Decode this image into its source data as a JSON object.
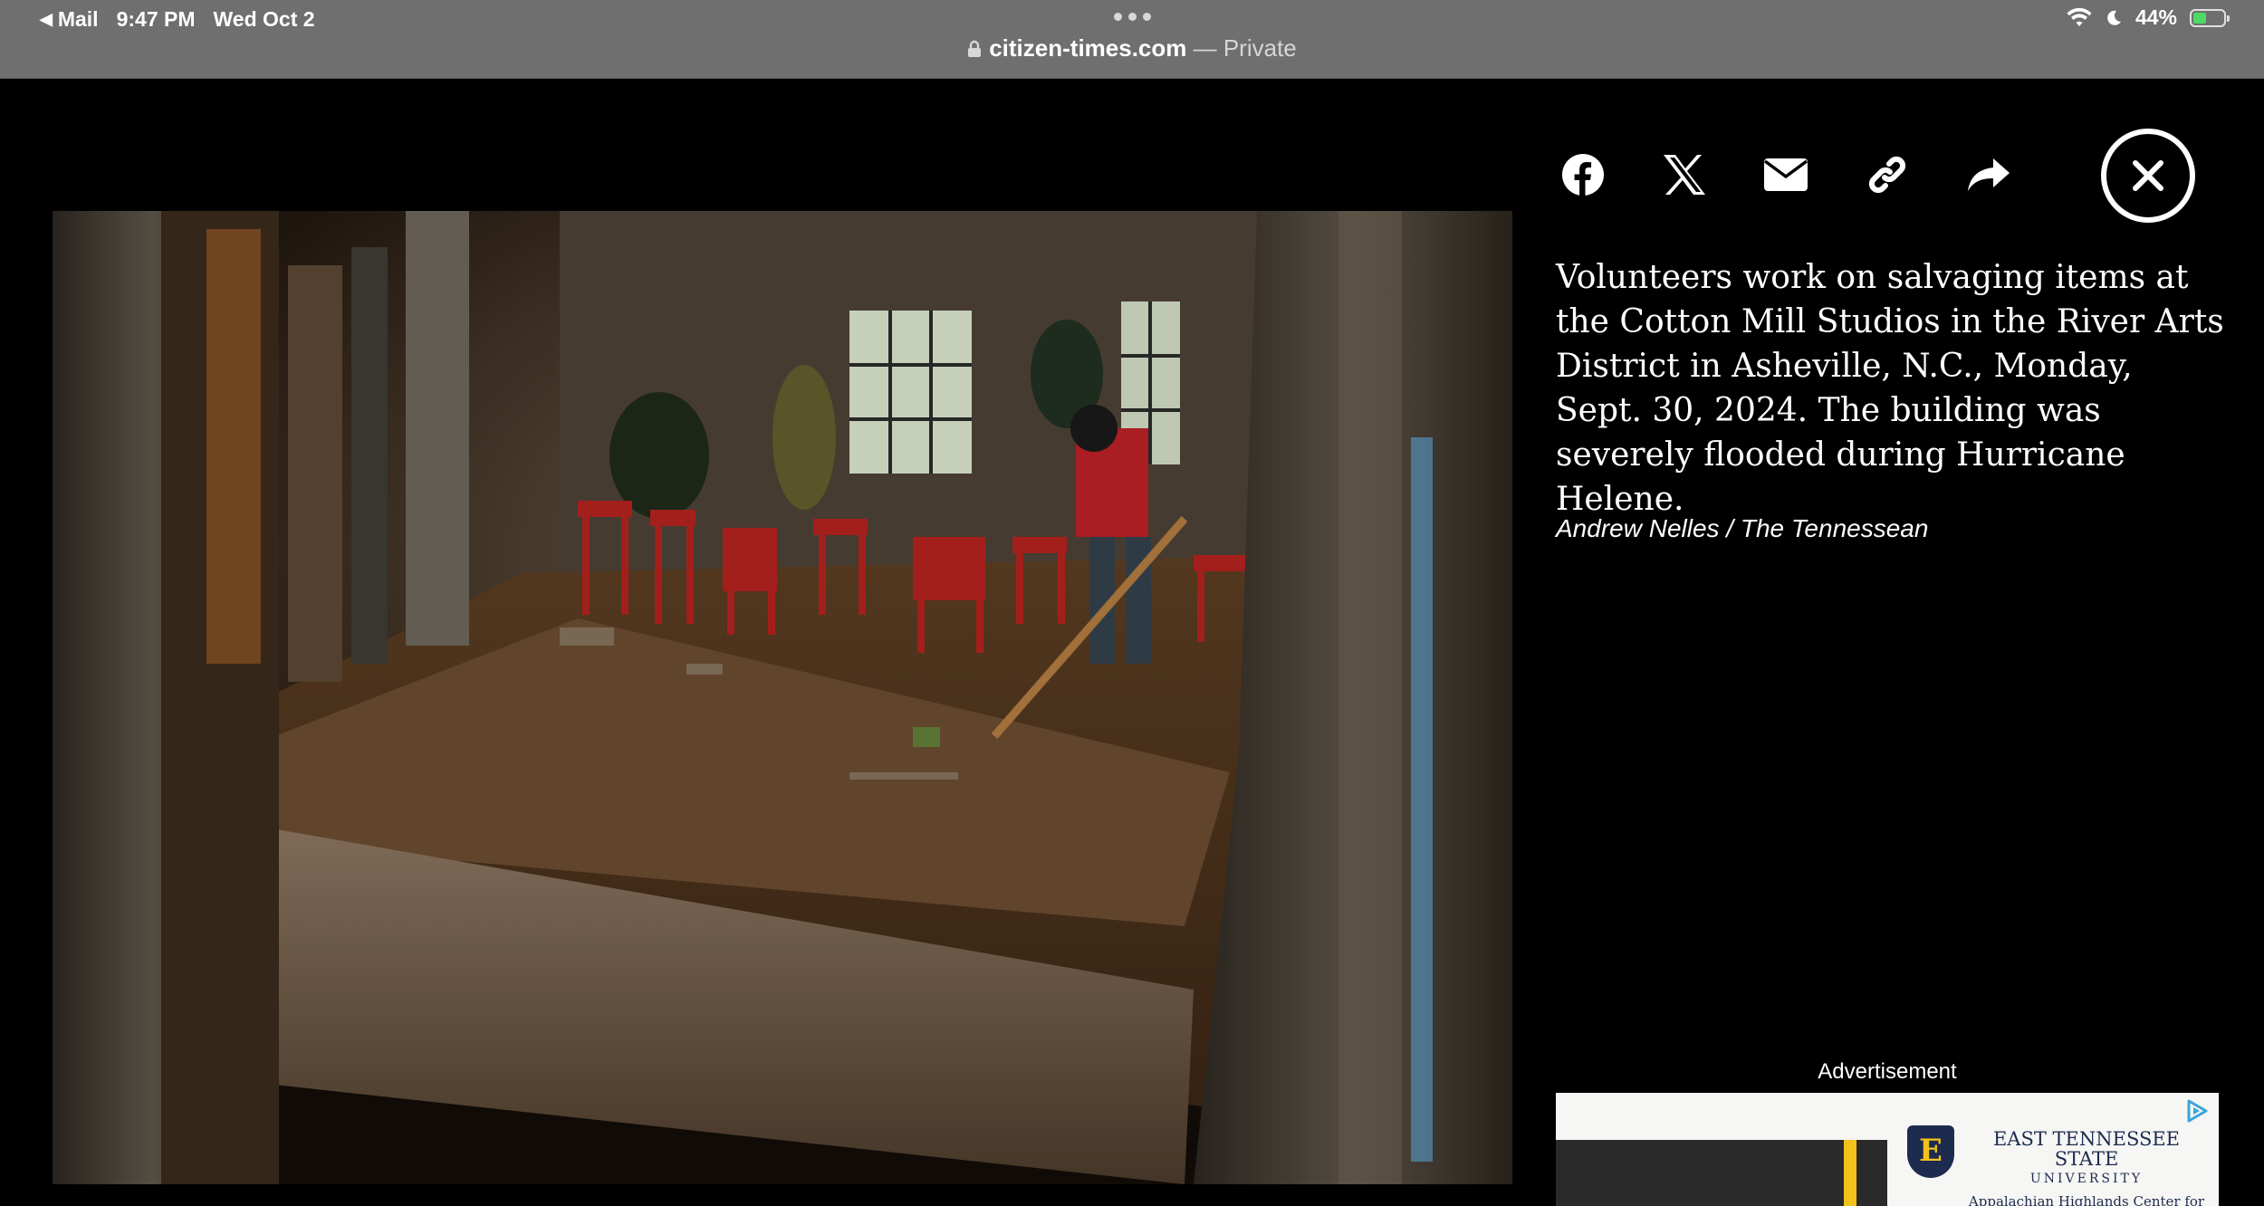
{
  "status_bar": {
    "back_app": "Mail",
    "time": "9:47 PM",
    "date": "Wed Oct 2",
    "battery": "44%"
  },
  "address_bar": {
    "domain": "citizen-times.com",
    "separator": " — ",
    "mode": "Private"
  },
  "share": {
    "items": [
      {
        "name": "facebook"
      },
      {
        "name": "x"
      },
      {
        "name": "email"
      },
      {
        "name": "copy-link"
      },
      {
        "name": "share"
      }
    ]
  },
  "photo": {
    "caption": "Volunteers work on salvaging items at the Cotton Mill Studios in the River Arts District in Asheville, N.C., Monday, Sept. 30, 2024. The building was severely flooded during Hurricane Helene.",
    "credit": "Andrew Nelles / The Tennessean"
  },
  "ad": {
    "label": "Advertisement",
    "logo_letter": "E",
    "name_line1": "EAST TENNESSEE STATE",
    "name_line2": "UNIVERSITY",
    "name_line3": "Appalachian Highlands Center for Nursing Advancement"
  }
}
